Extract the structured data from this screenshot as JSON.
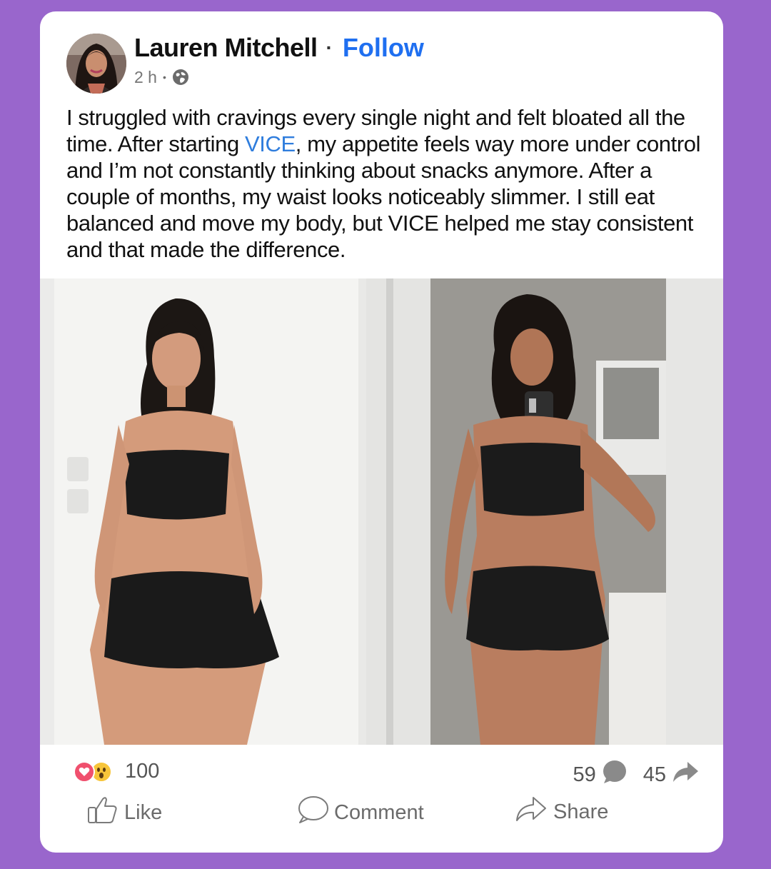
{
  "post": {
    "author": "Lauren Mitchell",
    "separator": "·",
    "follow_label": "Follow",
    "time": "2 h",
    "meta_separator": "•",
    "privacy_icon": "globe-icon",
    "text_before_link": "I struggled with cravings every single night and felt bloated all the time. After starting ",
    "link_text": "VICE",
    "text_after_link": ", my appetite feels way more under control and I’m not constantly thinking about snacks anymore. After a couple of months, my waist looks noticeably slimmer. I still eat balanced and move my body, but VICE helped me stay consistent and that made the difference."
  },
  "photos": {
    "before_icon": "before-photo",
    "after_icon": "after-photo"
  },
  "stats": {
    "reaction_icons": [
      "heart-reaction-icon",
      "wow-reaction-icon"
    ],
    "reaction_count": "100",
    "comment_count": "59",
    "share_count": "45"
  },
  "actions": {
    "like_label": "Like",
    "comment_label": "Comment",
    "share_label": "Share"
  },
  "colors": {
    "background": "#9966cc",
    "card": "#ffffff",
    "accent": "#1f6ff0",
    "link": "#2f7ddd"
  }
}
